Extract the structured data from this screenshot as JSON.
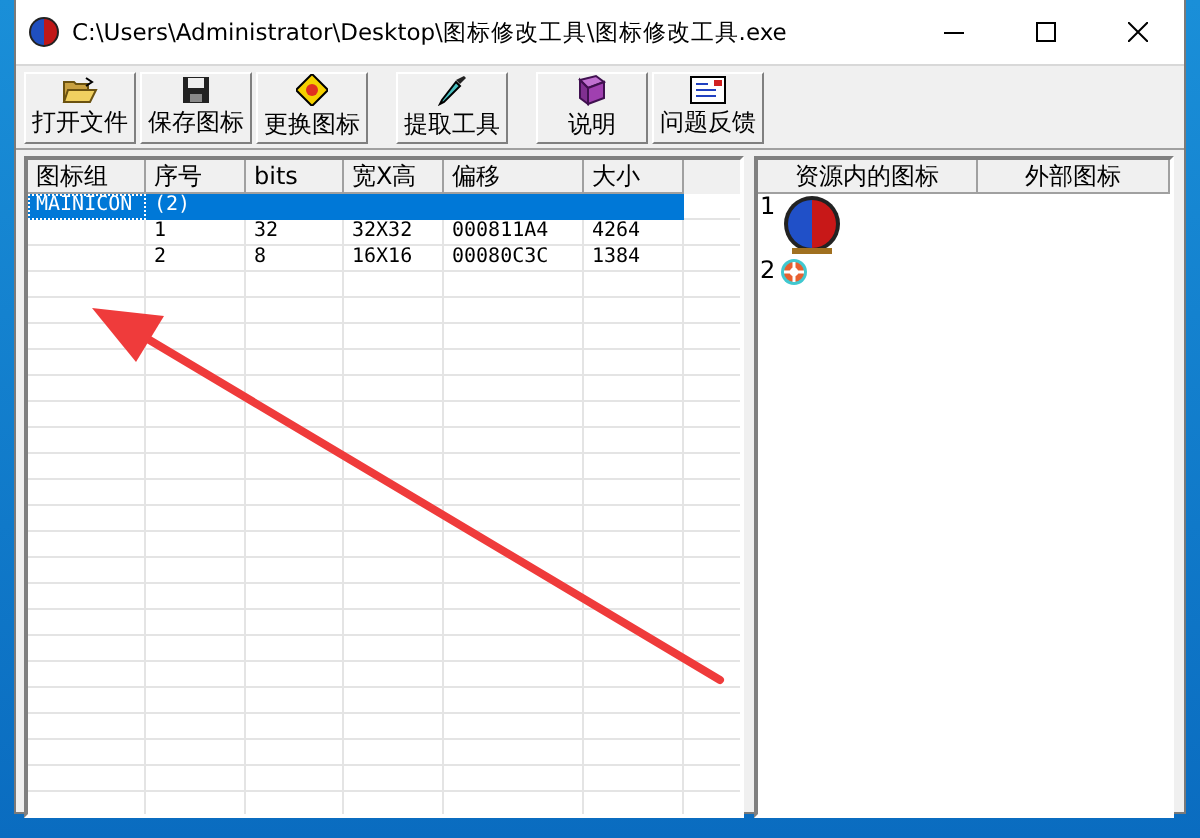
{
  "window": {
    "title": "C:\\Users\\Administrator\\Desktop\\图标修改工具\\图标修改工具.exe"
  },
  "toolbar": [
    {
      "label": "打开文件"
    },
    {
      "label": "保存图标"
    },
    {
      "label": "更换图标"
    },
    {
      "label": "提取工具"
    },
    {
      "label": "说明"
    },
    {
      "label": "问题反馈"
    }
  ],
  "table": {
    "columns": [
      "图标组",
      "序号",
      "bits",
      "宽X高",
      "偏移",
      "大小"
    ],
    "rows": [
      {
        "selected": true,
        "cells": [
          "MAINICON",
          "(2)",
          "",
          "",
          "",
          ""
        ]
      },
      {
        "selected": false,
        "cells": [
          "",
          "1",
          "32",
          "32X32",
          "000811A4",
          "4264"
        ]
      },
      {
        "selected": false,
        "cells": [
          "",
          "2",
          "8",
          "16X16",
          "00080C3C",
          "1384"
        ]
      }
    ]
  },
  "icon_panel": {
    "columns": [
      "资源内的图标",
      "外部图标"
    ],
    "items": [
      {
        "index": "1",
        "kind": "large"
      },
      {
        "index": "2",
        "kind": "small"
      }
    ]
  }
}
